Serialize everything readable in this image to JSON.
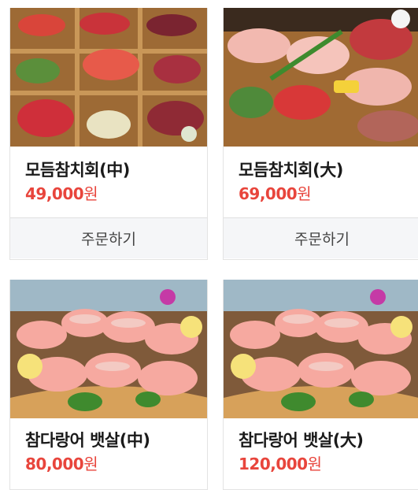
{
  "products": [
    {
      "name": "모듬참치회(中)",
      "price": "49,000",
      "unit": "원",
      "order_label": "주문하기",
      "image": "assorted-tuna-sashimi-box"
    },
    {
      "name": "모듬참치회(大)",
      "price": "69,000",
      "unit": "원",
      "order_label": "주문하기",
      "image": "assorted-tuna-sashimi-platter"
    },
    {
      "name": "참다랑어 뱃살(中)",
      "price": "80,000",
      "unit": "원",
      "image": "bluefin-belly-sashimi"
    },
    {
      "name": "참다랑어 뱃살(大)",
      "price": "120,000",
      "unit": "원",
      "image": "bluefin-belly-sashimi"
    }
  ],
  "colors": {
    "price": "#e8453c",
    "order_bg": "#f5f6f8",
    "border": "#e3e3e3"
  }
}
